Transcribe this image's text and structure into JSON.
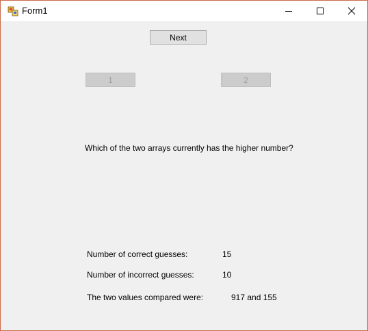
{
  "window": {
    "title": "Form1",
    "border_color": "#c86a4a"
  },
  "buttons": {
    "next": "Next",
    "option_one": "1",
    "option_two": "2"
  },
  "question": "Which of the two arrays currently has the higher number?",
  "stats": {
    "correct_label": "Number of correct guesses:",
    "correct_value": "15",
    "incorrect_label": "Number of incorrect guesses:",
    "incorrect_value": "10",
    "compared_label": "The two values compared were:",
    "compared_value": "917 and 155"
  }
}
